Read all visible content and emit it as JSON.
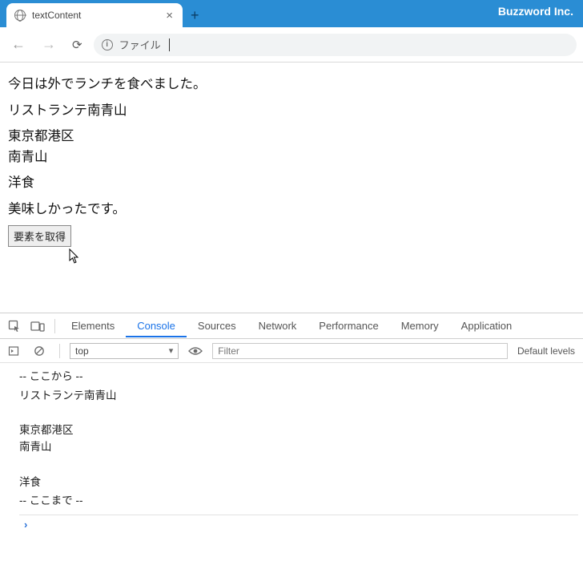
{
  "window": {
    "brand": "Buzzword Inc."
  },
  "tab": {
    "title": "textContent"
  },
  "omnibox": {
    "label": "ファイル"
  },
  "page": {
    "p1": "今日は外でランチを食べました。",
    "p2": "リストランテ南青山",
    "p3a": "東京都港区",
    "p3b": "南青山",
    "p4": "洋食",
    "p5": "美味しかったです。",
    "button": "要素を取得"
  },
  "devtools": {
    "tabs": {
      "elements": "Elements",
      "console": "Console",
      "sources": "Sources",
      "network": "Network",
      "performance": "Performance",
      "memory": "Memory",
      "application": "Application"
    },
    "context": "top",
    "filter_placeholder": "Filter",
    "levels": "Default levels",
    "console": {
      "l1": "-- ここから --",
      "l2": "リストランテ南青山",
      "l3": "東京都港区",
      "l4": "南青山",
      "l5": "洋食",
      "l6": "-- ここまで --"
    }
  }
}
